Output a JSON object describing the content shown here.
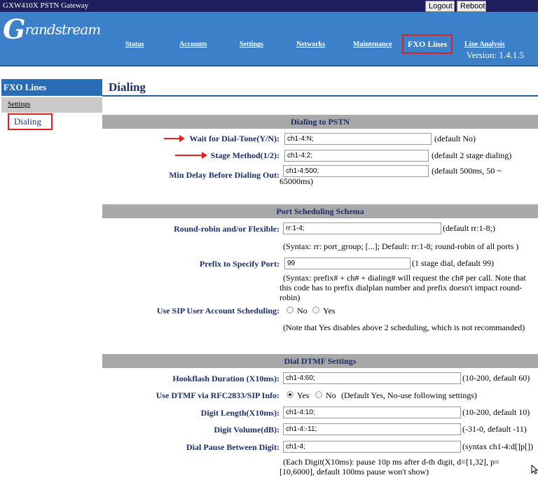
{
  "header": {
    "title": "GXW410X PSTN Gateway",
    "logout_label": "Logout",
    "reboot_label": "Reboot",
    "logo_text_big": "G",
    "logo_text": "randstream",
    "version": "Version: 1.4.1.5"
  },
  "nav": {
    "items": [
      {
        "label": "Status"
      },
      {
        "label": "Accounts"
      },
      {
        "label": "Settings"
      },
      {
        "label": "Networks"
      },
      {
        "label": "Maintenance"
      },
      {
        "label": "FXO Lines"
      },
      {
        "label": "Line Analysis"
      }
    ],
    "active": "FXO Lines"
  },
  "sidebar": {
    "heading": "FXO Lines",
    "subheading": "Settings",
    "item": "Dialing"
  },
  "page": {
    "title": "Dialing"
  },
  "sections": {
    "dialing_to_pstn": {
      "title": "Dialing to PSTN",
      "wait_dial_tone": {
        "label": "Wait for Dial-Tone(Y/N):",
        "value": "ch1-4:N;",
        "note": "(default No)"
      },
      "stage_method": {
        "label": "Stage Method(1/2):",
        "value": "ch1-4:2;",
        "note": "(default 2 stage dialing)"
      },
      "min_delay": {
        "label": "Min Delay Before Dialing Out:",
        "value": "ch1-4:500;",
        "note": "(default 500ms, 50 ~",
        "note2": "65000ms)"
      }
    },
    "port_scheduling": {
      "title": "Port Scheduling Schema",
      "round_robin": {
        "label": "Round-robin and/or Flexible:",
        "value": "rr:1-4;",
        "note": "(default rr:1-8;)",
        "syntax": "(Syntax: rr: port_group; [...]; Default: rr:1-8; round-robin of all ports )"
      },
      "prefix_port": {
        "label": "Prefix to Specify Port:",
        "value": "99",
        "note": "(1 stage dial, default 99)",
        "syntax": "(Syntax: prefix# + ch# + dialing# will request the ch# per call. Note that this code has to prefix dialplan number and prefix doesn't impact round-robin)"
      },
      "sip_scheduling": {
        "label": "Use SIP User Account Scheduling:",
        "no_label": "No",
        "yes_label": "Yes",
        "selected": "none",
        "note": "(Note that Yes disables above 2 scheduling, which is not recommanded)"
      }
    },
    "dial_dtmf": {
      "title": "Dial DTMF Settings",
      "hookflash": {
        "label": "Hookflash Duration (X10ms):",
        "value": "ch1-4:60;",
        "note": "(10-200, default 60)"
      },
      "use_dtmf": {
        "label": "Use DTMF via RFC2833/SIP Info:",
        "yes_label": "Yes",
        "no_label": "No",
        "selected": "Yes",
        "note": "(Default Yes, No-use following settings)"
      },
      "digit_length": {
        "label": "Digit Length(X10ms):",
        "value": "ch1-4:10;",
        "note": "(10-200, default 10)"
      },
      "digit_volume": {
        "label": "Digit Volume(dB):",
        "value": "ch1-4:-11;",
        "note": "(-31-0, default -11)"
      },
      "dial_pause": {
        "label": "Dial Pause Between Digit:",
        "value": "ch1-4;",
        "note": "(syntax ch1-4:d[]p[])",
        "syntax": "(Each Digit(X10ms): pause 10p ms after d-th digit, d=[1,32], p=[10,6000], default 100ms pause won't show)"
      }
    }
  },
  "colors": {
    "topbar": "#1f1f5e",
    "banner": "#3b80c8",
    "highlight": "#e02020",
    "section_bar": "#a9a9a9",
    "label_text": "#1a2e6a"
  }
}
